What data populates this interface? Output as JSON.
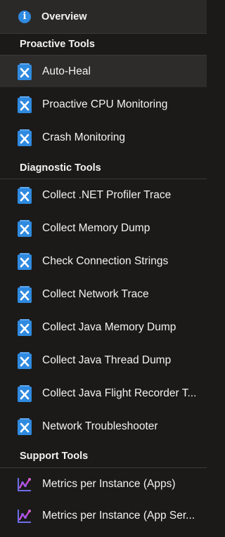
{
  "overview": {
    "label": "Overview",
    "icon": "info-icon"
  },
  "sections": [
    {
      "title": "Proactive Tools",
      "items": [
        {
          "label": "Auto-Heal",
          "icon": "tool-icon",
          "selected": true
        },
        {
          "label": "Proactive CPU Monitoring",
          "icon": "tool-icon"
        },
        {
          "label": "Crash Monitoring",
          "icon": "tool-icon"
        }
      ]
    },
    {
      "title": "Diagnostic Tools",
      "items": [
        {
          "label": "Collect .NET Profiler Trace",
          "icon": "tool-icon"
        },
        {
          "label": "Collect Memory Dump",
          "icon": "tool-icon"
        },
        {
          "label": "Check Connection Strings",
          "icon": "tool-icon"
        },
        {
          "label": "Collect Network Trace",
          "icon": "tool-icon"
        },
        {
          "label": "Collect Java Memory Dump",
          "icon": "tool-icon"
        },
        {
          "label": "Collect Java Thread Dump",
          "icon": "tool-icon"
        },
        {
          "label": "Collect Java Flight Recorder T...",
          "icon": "tool-icon"
        },
        {
          "label": "Network Troubleshooter",
          "icon": "tool-icon"
        }
      ]
    },
    {
      "title": "Support Tools",
      "items": [
        {
          "label": "Metrics per Instance (Apps)",
          "icon": "metrics-chart-icon"
        },
        {
          "label": "Metrics per Instance (App Ser...",
          "icon": "metrics-chart-icon"
        }
      ]
    }
  ],
  "colors": {
    "accent": "#2f8ae0",
    "selected_bg": "#2d2c2b",
    "background": "#1b1a19"
  }
}
